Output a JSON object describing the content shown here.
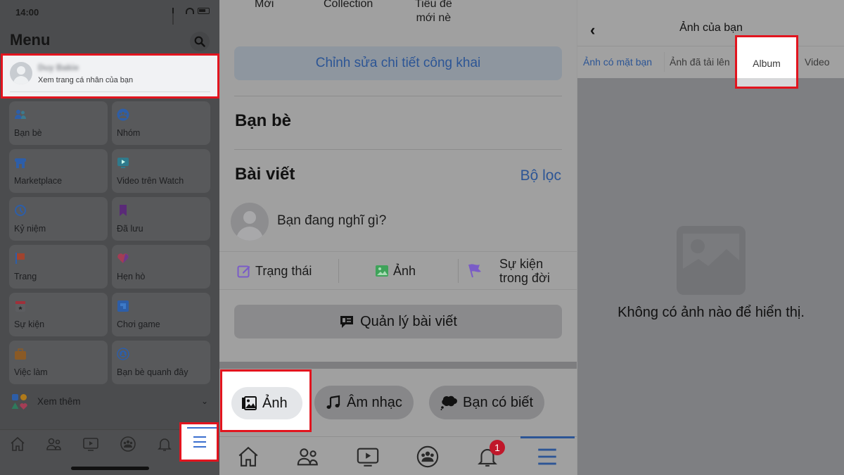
{
  "panel_menu": {
    "status_time": "14:00",
    "title": "Menu",
    "profile": {
      "name": "Duy Bakie",
      "subtitle": "Xem trang cá nhân của bạn"
    },
    "shortcuts": [
      {
        "label": "Bạn bè",
        "icon": "friends-icon"
      },
      {
        "label": "Nhóm",
        "icon": "groups-icon"
      },
      {
        "label": "Marketplace",
        "icon": "marketplace-icon"
      },
      {
        "label": "Video trên Watch",
        "icon": "watch-icon"
      },
      {
        "label": "Kỷ niệm",
        "icon": "memories-icon"
      },
      {
        "label": "Đã lưu",
        "icon": "saved-icon"
      },
      {
        "label": "Trang",
        "icon": "pages-icon"
      },
      {
        "label": "Hẹn hò",
        "icon": "dating-icon"
      },
      {
        "label": "Sự kiện",
        "icon": "events-icon"
      },
      {
        "label": "Chơi game",
        "icon": "gaming-icon"
      },
      {
        "label": "Việc làm",
        "icon": "jobs-icon"
      },
      {
        "label": "Bạn bè quanh đây",
        "icon": "nearby-friends-icon"
      }
    ],
    "see_more": "Xem thêm",
    "nav": [
      "home",
      "friends",
      "watch",
      "groups",
      "notifications",
      "menu"
    ]
  },
  "panel_profile": {
    "top_tabs": [
      "Mới",
      "Collection",
      "Tiêu đề\nmới nè"
    ],
    "edit_public_details": "Chỉnh sửa chi tiết công khai",
    "friends_title": "Bạn bè",
    "posts_title": "Bài viết",
    "filter_link": "Bộ lọc",
    "composer_placeholder": "Bạn đang nghĩ gì?",
    "actions": [
      {
        "label": "Trạng thái",
        "icon": "edit-status-icon",
        "color": "#7a5cc7"
      },
      {
        "label": "Ảnh",
        "icon": "photo-icon",
        "color": "#3fa35a"
      },
      {
        "label": "Sự kiện\ntrong đời",
        "icon": "flag-icon",
        "color": "#7a5cc7"
      }
    ],
    "manage_posts": "Quản lý bài viết",
    "chips": [
      "Ảnh",
      "Âm nhạc",
      "Bạn có biết"
    ],
    "notification_badge": "1"
  },
  "panel_photos": {
    "title": "Ảnh của bạn",
    "tabs": [
      "Ảnh có mặt bạn",
      "Ảnh đã tải lên",
      "Album",
      "Video"
    ],
    "active_tab": "Ảnh có mặt bạn",
    "highlighted_tab": "Album",
    "empty_message": "Không có ảnh nào để hiển thị."
  },
  "colors": {
    "highlight_border": "#e2141e",
    "link_blue": "#2c5595",
    "badge_red": "#c0172a"
  }
}
